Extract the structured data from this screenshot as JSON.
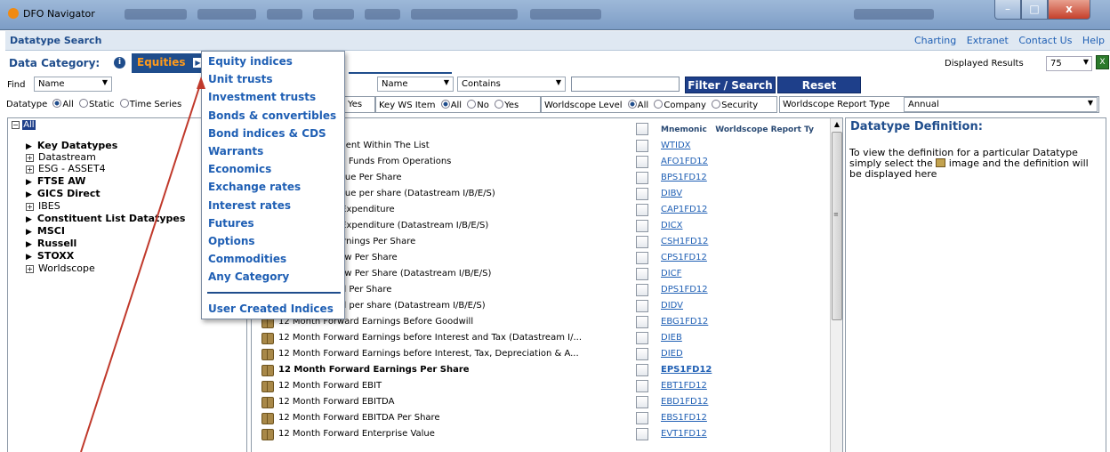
{
  "window": {
    "app_title": "DFO Navigator",
    "controls": {
      "minimize": "–",
      "maximize": "□",
      "close": "x"
    }
  },
  "header": {
    "page_title": "Datatype Search",
    "links": [
      "Charting",
      "Extranet",
      "Contact Us",
      "Help"
    ]
  },
  "category": {
    "label": "Data Category:",
    "info_icon": "i",
    "selected": "Equities",
    "arrow": "▶",
    "displayed_label": "Displayed Results",
    "displayed_value": "75",
    "export_icon": "excel-export-icon",
    "export_glyph": "X"
  },
  "find": {
    "label": "Find",
    "field_select": "Name",
    "name_select": "Name",
    "operator_select": "Contains",
    "search_value": "",
    "filter_button": "Filter / Search",
    "reset_button": "Reset"
  },
  "filters": {
    "datatype_label": "Datatype",
    "datatype_options": [
      "All",
      "Static",
      "Time Series"
    ],
    "yes_fragment": "Yes",
    "keyws_label": "Key WS Item",
    "keyws_options": [
      "All",
      "No",
      "Yes"
    ],
    "wslevel_label": "Worldscope Level",
    "wslevel_options": [
      "All",
      "Company",
      "Security"
    ],
    "report_type_label": "Worldscope Report Type",
    "report_type_value": "Annual"
  },
  "tree": {
    "root_expander": "−",
    "root": "All",
    "items": [
      {
        "label": "Key Datatypes",
        "style": "arrow"
      },
      {
        "label": "Datastream",
        "style": "plus"
      },
      {
        "label": "ESG - ASSET4",
        "style": "plus"
      },
      {
        "label": "FTSE AW",
        "style": "arrow"
      },
      {
        "label": "GICS Direct",
        "style": "arrow"
      },
      {
        "label": "IBES",
        "style": "plus"
      },
      {
        "label": "Constituent List Datatypes",
        "style": "arrow"
      },
      {
        "label": "MSCI",
        "style": "arrow"
      },
      {
        "label": "Russell",
        "style": "arrow"
      },
      {
        "label": "STOXX",
        "style": "arrow"
      },
      {
        "label": "Worldscope",
        "style": "plus"
      }
    ]
  },
  "dropdown": {
    "items": [
      "Equity indices",
      "Unit trusts",
      "Investment trusts",
      "Bonds & convertibles",
      "Bond indices & CDS",
      "Warrants",
      "Economics",
      "Exchange rates",
      "Interest rates",
      "Futures",
      "Options",
      "Commodities",
      "Any Category"
    ],
    "footer_item": "User Created Indices"
  },
  "results": {
    "header_mnemonic": "Mnemonic",
    "header_report": "Worldscope Report Ty",
    "rows": [
      {
        "desc": "f Each Constituent Within The List",
        "mnem": "WTIDX",
        "bold": false
      },
      {
        "desc": "rward Adjusted Funds From Operations",
        "mnem": "AFO1FD12",
        "bold": false
      },
      {
        "desc": "rward Book Value Per Share",
        "mnem": "BPS1FD12",
        "bold": false
      },
      {
        "desc": "rward Book Value per share (Datastream I/B/E/S)",
        "mnem": "DIBV",
        "bold": false
      },
      {
        "desc": "rward Capital Expenditure",
        "mnem": "CAP1FD12",
        "bold": false
      },
      {
        "desc": "rward Capital Expenditure (Datastream I/B/E/S)",
        "mnem": "DICX",
        "bold": false
      },
      {
        "desc": "rward Cash Earnings Per Share",
        "mnem": "CSH1FD12",
        "bold": false
      },
      {
        "desc": "rward Cash Flow Per Share",
        "mnem": "CPS1FD12",
        "bold": false
      },
      {
        "desc": "rward Cash Flow Per Share (Datastream I/B/E/S)",
        "mnem": "DICF",
        "bold": false
      },
      {
        "desc": "rward Dividend Per Share",
        "mnem": "DPS1FD12",
        "bold": false
      },
      {
        "desc": "rward Dividend per share (Datastream I/B/E/S)",
        "mnem": "DIDV",
        "bold": false
      },
      {
        "desc": "12 Month Forward Earnings Before Goodwill",
        "mnem": "EBG1FD12",
        "bold": false
      },
      {
        "desc": "12 Month Forward Earnings before Interest and Tax (Datastream I/...",
        "mnem": "DIEB",
        "bold": false
      },
      {
        "desc": "12 Month Forward Earnings before Interest, Tax, Depreciation & A...",
        "mnem": "DIED",
        "bold": false
      },
      {
        "desc": "12 Month Forward Earnings Per Share",
        "mnem": "EPS1FD12",
        "bold": true
      },
      {
        "desc": "12 Month Forward EBIT",
        "mnem": "EBT1FD12",
        "bold": false
      },
      {
        "desc": "12 Month Forward EBITDA",
        "mnem": "EBD1FD12",
        "bold": false
      },
      {
        "desc": "12 Month Forward EBITDA Per Share",
        "mnem": "EBS1FD12",
        "bold": false
      },
      {
        "desc": "12 Month Forward Enterprise Value",
        "mnem": "EVT1FD12",
        "bold": false
      }
    ]
  },
  "definition": {
    "title": "Datatype Definition:",
    "text_before": "To view the definition for a particular Datatype simply select the",
    "text_after": "image and the definition will be displayed here"
  },
  "colors": {
    "accent": "#1f4d8c",
    "category_text": "#ff9a1a",
    "link": "#1f5fb4",
    "annotation_line": "#c0392b"
  }
}
